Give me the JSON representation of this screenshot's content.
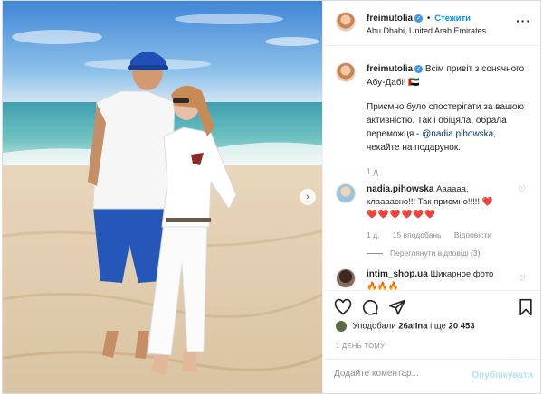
{
  "header": {
    "username": "freimutolia",
    "verified_mark": "✓",
    "separator": "•",
    "follow_label": "Стежити",
    "location": "Abu Dhabi, United Arab Emirates",
    "more_icon": "more-dots-icon"
  },
  "caption": {
    "username": "freimutolia",
    "line1": "Всім привіт з сонячного Абу-Дабі! 🇦🇪",
    "line2a": "Приємно було спостерігати за вашою активністю. Так і обіцяла, обрала переможця -",
    "mention": "@nadia.pihowska",
    "line2b": ", чекайте на подарунок.",
    "time": "1 д."
  },
  "comments": [
    {
      "username": "nadia.pihowska",
      "text": "Аааааа, клаааасно!!! Так приємно!!!!! ❤️",
      "hearts": "❤️❤️❤️❤️❤️❤️",
      "time": "1 д.",
      "likes": "15 вподобань",
      "reply": "Відповісти",
      "view_replies": "Переглянути відповіді (3)"
    },
    {
      "username": "intim_shop.ua",
      "text": "Шикарное фото",
      "emoji": "🔥🔥🔥"
    }
  ],
  "likes": {
    "prefix": "Уподобали",
    "user": "26alina",
    "suffix": "і ще",
    "count": "20 453"
  },
  "timestamp": "1 день тому",
  "add_comment": {
    "placeholder": "Додайте коментар...",
    "publish": "Опублікувати"
  },
  "icons": {
    "like": "heart-icon",
    "comment": "comment-icon",
    "share": "share-icon",
    "save": "bookmark-icon",
    "next": "chevron-right-icon"
  },
  "colors": {
    "accent": "#0095f6",
    "heart": "#ed4956",
    "muted": "#8e8e8e"
  }
}
